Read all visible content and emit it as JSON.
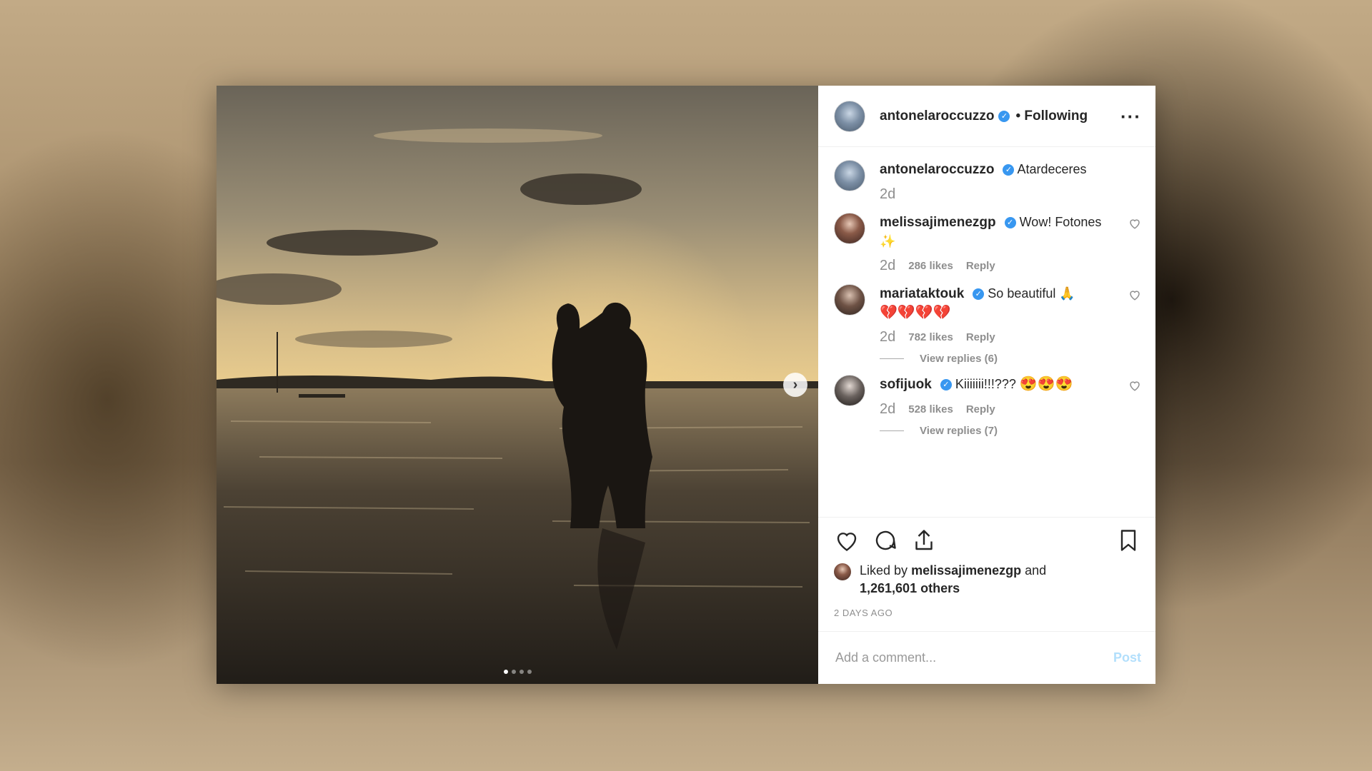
{
  "post": {
    "author": "antonelaroccuzzo",
    "follow_status": "• Following",
    "more": "···",
    "carousel_next": "›"
  },
  "caption": {
    "username": "antonelaroccuzzo",
    "text": "Atardeceres",
    "time": "2d"
  },
  "comments": [
    {
      "username": "melissajimenezgp",
      "text": "Wow! Fotones ✨",
      "time": "2d",
      "likes": "286 likes",
      "reply": "Reply"
    },
    {
      "username": "mariataktouk",
      "text": "So beautiful 🙏",
      "extra": "💔💔💔💔",
      "time": "2d",
      "likes": "782 likes",
      "reply": "Reply",
      "view_replies": "View replies (6)"
    },
    {
      "username": "sofijuok",
      "text": "Kiiiiiii!!!???",
      "extra": "😍😍😍",
      "time": "2d",
      "likes": "528 likes",
      "reply": "Reply",
      "view_replies": "View replies (7)"
    }
  ],
  "likes": {
    "prefix": "Liked by",
    "user": "melissajimenezgp",
    "and": "and",
    "count": "1,261,601 others"
  },
  "timestamp": "2 DAYS AGO",
  "add_comment": {
    "placeholder": "Add a comment...",
    "post_label": "Post"
  },
  "icons": [
    "heart-icon",
    "comment-icon",
    "share-icon",
    "bookmark-icon",
    "verified-icon",
    "chevron-right-icon"
  ],
  "colors": {
    "verified": "#3897f0",
    "post_disabled": "#b2dffc",
    "text": "#262626",
    "muted": "#8e8e8e"
  }
}
